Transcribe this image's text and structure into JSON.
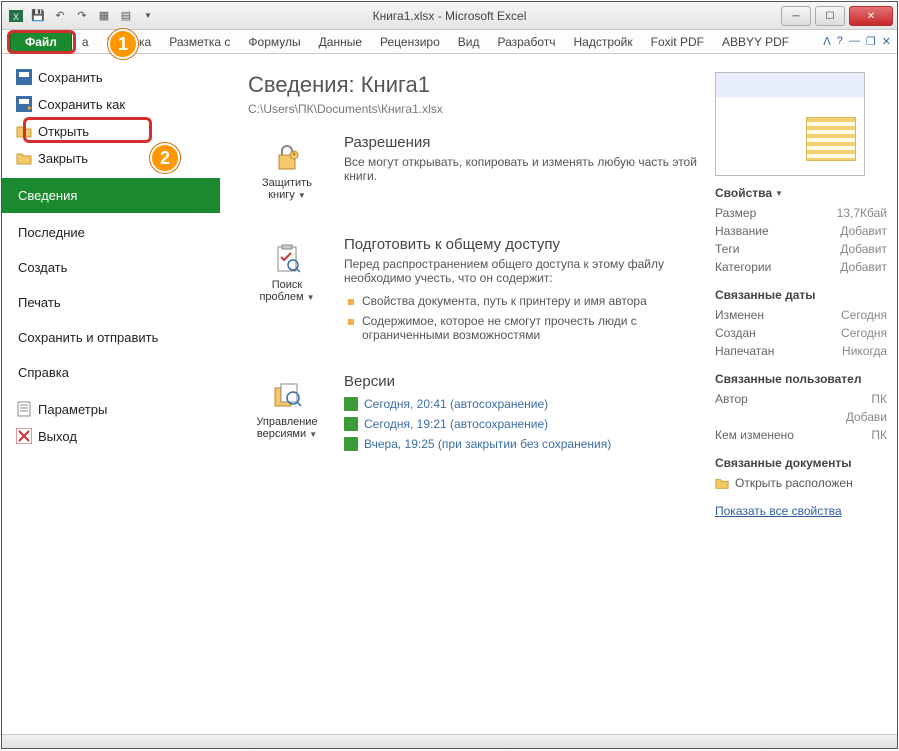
{
  "window": {
    "title": "Книга1.xlsx  -  Microsoft Excel"
  },
  "ribbon": {
    "file": "Файл",
    "tabs": [
      "а",
      "Вставка",
      "Разметка с",
      "Формулы",
      "Данные",
      "Рецензиро",
      "Вид",
      "Разработч",
      "Надстройк",
      "Foxit PDF",
      "ABBYY PDF"
    ]
  },
  "side": {
    "save": "Сохранить",
    "save_as": "Сохранить как",
    "open": "Открыть",
    "close": "Закрыть",
    "info": "Сведения",
    "recent": "Последние",
    "new": "Создать",
    "print": "Печать",
    "share": "Сохранить и отправить",
    "help": "Справка",
    "options": "Параметры",
    "exit": "Выход"
  },
  "info": {
    "heading": "Сведения: Книга1",
    "path": "C:\\Users\\ПК\\Documents\\Книга1.xlsx",
    "protect_btn": "Защитить книгу",
    "protect_title": "Разрешения",
    "protect_desc": "Все могут открывать, копировать и изменять любую часть этой книги.",
    "check_btn": "Поиск проблем",
    "check_title": "Подготовить к общему доступу",
    "check_desc": "Перед распространением общего доступа к этому файлу необходимо учесть, что он содержит:",
    "check_li1": "Свойства документа, путь к принтеру и имя автора",
    "check_li2": "Содержимое, которое не смогут прочесть люди с ограниченными возможностями",
    "versions_btn": "Управление версиями",
    "versions_title": "Версии",
    "v1": "Сегодня, 20:41 (автосохранение)",
    "v2": "Сегодня, 19:21 (автосохранение)",
    "v3": "Вчера, 19:25 (при закрытии без сохранения)"
  },
  "props": {
    "head": "Свойства",
    "size_k": "Размер",
    "size_v": "13,7Кбай",
    "title_k": "Название",
    "title_v": "Добавит",
    "tags_k": "Теги",
    "tags_v": "Добавит",
    "cat_k": "Категории",
    "cat_v": "Добавит",
    "dates_head": "Связанные даты",
    "mod_k": "Изменен",
    "mod_v": "Сегодня",
    "created_k": "Создан",
    "created_v": "Сегодня",
    "printed_k": "Напечатан",
    "printed_v": "Никогда",
    "users_head": "Связанные пользовател",
    "author_k": "Автор",
    "author_v": "ПК",
    "addauthor_v": "Добави",
    "changed_k": "Кем изменено",
    "changed_v": "ПК",
    "docs_head": "Связанные документы",
    "open_loc": "Открыть расположен",
    "show_all": "Показать все свойства"
  },
  "annot": {
    "one": "1",
    "two": "2"
  }
}
